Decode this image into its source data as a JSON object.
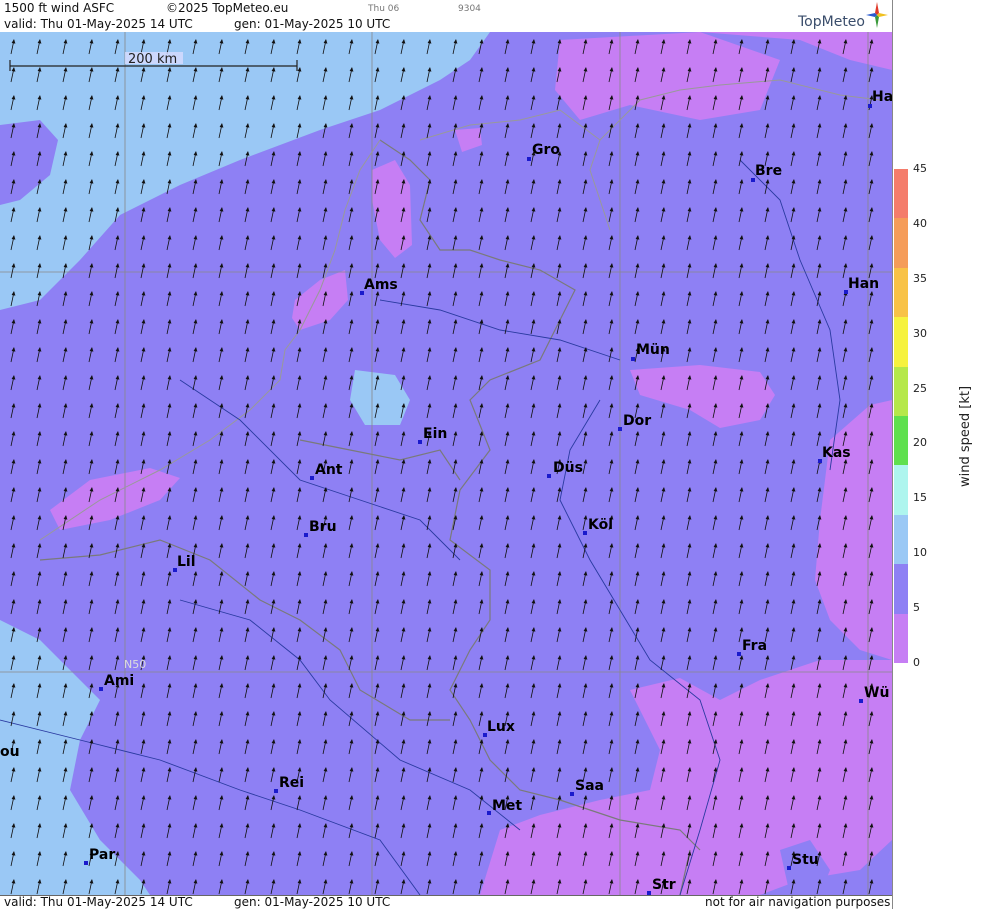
{
  "header": {
    "title": "1500 ft wind ASFC",
    "copyright": "©2025 TopMeteo.eu",
    "valid": "valid:  Thu  01-May-2025  14 UTC",
    "gen": "gen: 01-May-2025 10 UTC",
    "small1": "Thu 06",
    "small2": "9304",
    "logo": "TopMeteo"
  },
  "footer": {
    "valid": "valid:  Thu  01-May-2025  14 UTC",
    "gen": "gen: 01-May-2025 10 UTC",
    "note": "not for air navigation purposes"
  },
  "map": {
    "scale_label": "200 km",
    "lat_label": "N50",
    "cities": [
      {
        "name": "Gro"
      },
      {
        "name": "Bre"
      },
      {
        "name": "Ha"
      },
      {
        "name": "Ams"
      },
      {
        "name": "Han"
      },
      {
        "name": "Mün"
      },
      {
        "name": "Dor"
      },
      {
        "name": "Ein"
      },
      {
        "name": "Kas"
      },
      {
        "name": "Düs"
      },
      {
        "name": "Ant"
      },
      {
        "name": "Köl"
      },
      {
        "name": "Bru"
      },
      {
        "name": "Lil"
      },
      {
        "name": "Fra"
      },
      {
        "name": "Ami"
      },
      {
        "name": "Wü"
      },
      {
        "name": "Lux"
      },
      {
        "name": "ou"
      },
      {
        "name": "Rei"
      },
      {
        "name": "Saa"
      },
      {
        "name": "Met"
      },
      {
        "name": "Par"
      },
      {
        "name": "Stu"
      },
      {
        "name": "Str"
      }
    ]
  },
  "colorbar": {
    "label": "wind  speed  [kt]",
    "ticks": [
      "45",
      "40",
      "35",
      "30",
      "25",
      "20",
      "15",
      "10",
      "5",
      "0"
    ],
    "colors": [
      "#f47c6b",
      "#f59c59",
      "#f8c246",
      "#f6f23e",
      "#b5e84a",
      "#5fe04e",
      "#aef5ee",
      "#9ac8f5",
      "#8e80f4",
      "#c67ef4"
    ]
  }
}
